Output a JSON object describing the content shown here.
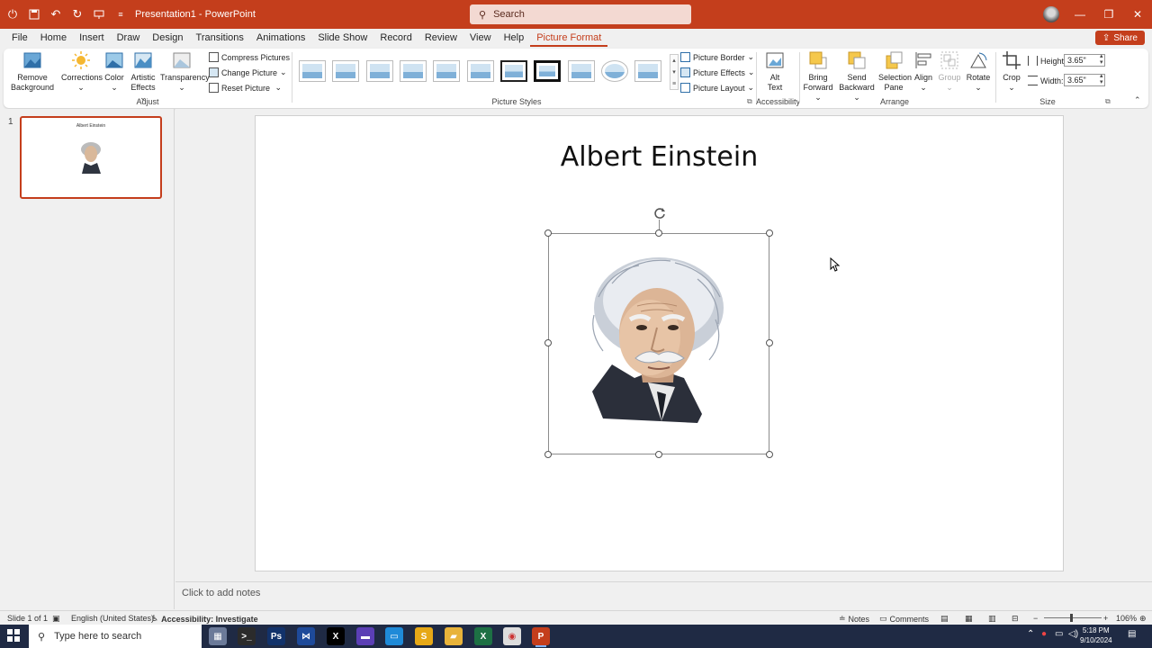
{
  "titlebar": {
    "doc_title": "Presentation1 - PowerPoint",
    "search_placeholder": "Search",
    "controls": [
      "—",
      "❐",
      "✕"
    ]
  },
  "menu": {
    "tabs": [
      "File",
      "Home",
      "Insert",
      "Draw",
      "Design",
      "Transitions",
      "Animations",
      "Slide Show",
      "Record",
      "Review",
      "View",
      "Help",
      "Picture Format"
    ],
    "active_tab": "Picture Format",
    "share_label": "Share"
  },
  "ribbon": {
    "adjust": {
      "label": "Adjust",
      "remove_background": [
        "Remove",
        "Background"
      ],
      "corrections": "Corrections",
      "color": "Color",
      "artistic_effects": [
        "Artistic",
        "Effects"
      ],
      "transparency": "Transparency",
      "compress": "Compress Pictures",
      "change": "Change Picture",
      "reset": "Reset Picture"
    },
    "picture_styles": {
      "label": "Picture Styles",
      "border": "Picture Border",
      "effects": "Picture Effects",
      "layout": "Picture Layout"
    },
    "accessibility": {
      "label": "Accessibility",
      "alt_text": [
        "Alt",
        "Text"
      ]
    },
    "arrange": {
      "label": "Arrange",
      "bring_forward": [
        "Bring",
        "Forward"
      ],
      "send_backward": [
        "Send",
        "Backward"
      ],
      "selection_pane": [
        "Selection",
        "Pane"
      ],
      "align": "Align",
      "group": "Group",
      "rotate": "Rotate"
    },
    "size": {
      "label": "Size",
      "crop": "Crop",
      "height_label": "Height:",
      "height_value": "3.65\"",
      "width_label": "Width:",
      "width_value": "3.65\""
    }
  },
  "thumbnails": {
    "slide_number": "1",
    "thumb_title": "Albert Einstein"
  },
  "slide": {
    "title": "Albert Einstein"
  },
  "notes": {
    "placeholder": "Click to add notes"
  },
  "status": {
    "slide_count": "Slide 1 of 1",
    "language": "English (United States)",
    "accessibility": "Accessibility: Investigate",
    "notes": "Notes",
    "comments": "Comments",
    "zoom": "106%"
  },
  "taskbar": {
    "search_placeholder": "Type here to search",
    "time": "5:18 PM",
    "date": "9/10/2024"
  },
  "colors": {
    "accent": "#c43e1c",
    "taskbar": "#1f2a44"
  }
}
